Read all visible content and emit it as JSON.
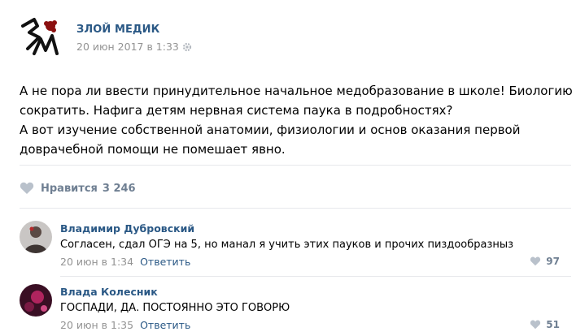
{
  "post": {
    "author": "ЗЛОЙ МЕДИК",
    "date": "20 июн 2017 в 1:33",
    "text_lines": [
      "А не пора ли ввести принудительное начальное медобразование в школе! Биологию",
      "сократить. Нафига детям нервная система паука в подробностях?",
      "А вот изучение собственной анатомии, физиологии и основ оказания первой",
      "доврачебной помощи не помешает явно."
    ],
    "like_label": "Нравится",
    "like_count": "3 246",
    "icons": {
      "options": "gear-icon",
      "like": "heart-icon"
    }
  },
  "comments": [
    {
      "author": "Владимир Дубровский",
      "text": "Согласен, сдал ОГЭ на 5, но манал я учить этих пауков и прочих пиздообразныз",
      "date": "20 июн в 1:34",
      "reply_label": "Ответить",
      "likes": "97"
    },
    {
      "author": "Влада Колесник",
      "text": "ГОСПАДИ, ДА. ПОСТОЯННО ЭТО ГОВОРЮ",
      "date": "20 июн в 1:35",
      "reply_label": "Ответить",
      "likes": "51"
    }
  ],
  "colors": {
    "link": "#2a5885",
    "muted": "#939393",
    "like": "#6f7f92",
    "separator": "#e7e8ec",
    "logo_accent": "#8b1010"
  }
}
